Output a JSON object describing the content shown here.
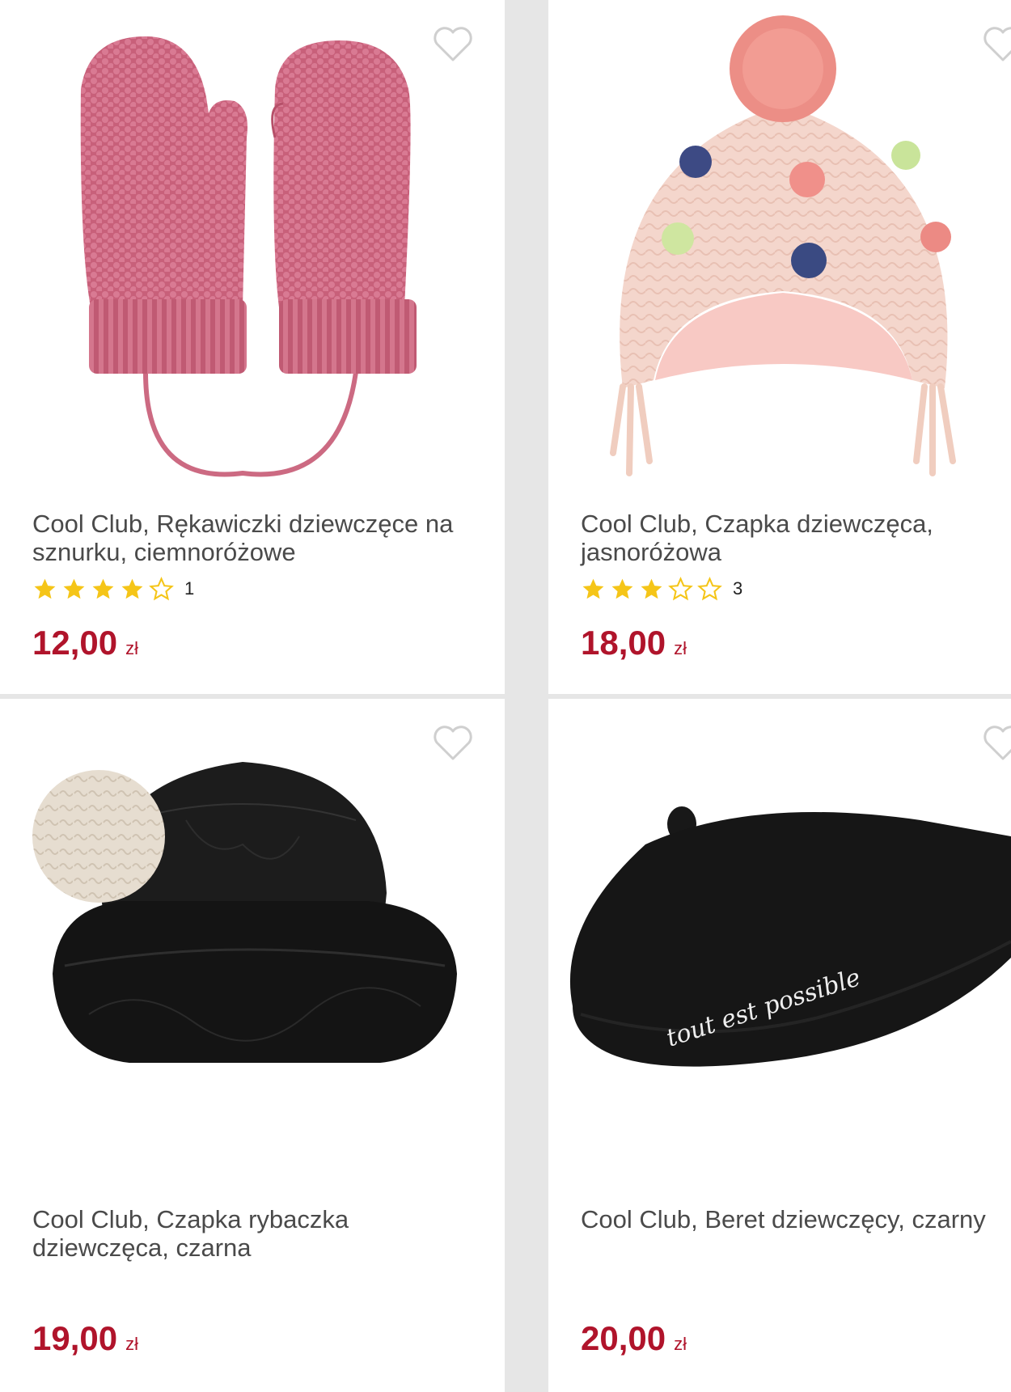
{
  "products": [
    {
      "title": "Cool Club, Rękawiczki dziewczęce na sznurku, ciemnoróżowe",
      "image": "pink-knitted-mittens-on-string",
      "rating": 4,
      "rating_count": "1",
      "price": "12,00",
      "currency": "zł"
    },
    {
      "title": "Cool Club, Czapka dziewczęca, jasnoróżowa",
      "image": "light-pink-pompom-hat-with-earflaps",
      "rating": 3,
      "rating_count": "3",
      "price": "18,00",
      "currency": "zł"
    },
    {
      "title": "Cool Club, Czapka rybaczka dziewczęca, czarna",
      "image": "black-quilted-bucket-hat",
      "price": "19,00",
      "currency": "zł"
    },
    {
      "title": "Cool Club, Beret dziewczęcy, czarny",
      "image": "black-beret",
      "beret_text": "tout est possible",
      "price": "20,00",
      "currency": "zł"
    }
  ],
  "colors": {
    "price": "#b0142b",
    "star_filled": "#f5c518",
    "star_empty_outline": "#f5c518",
    "card_bg": "#ffffff",
    "grid_gap": "#e6e6e6"
  },
  "icons": {
    "favorite": "heart-outline-icon",
    "rating_star": "star-icon"
  }
}
